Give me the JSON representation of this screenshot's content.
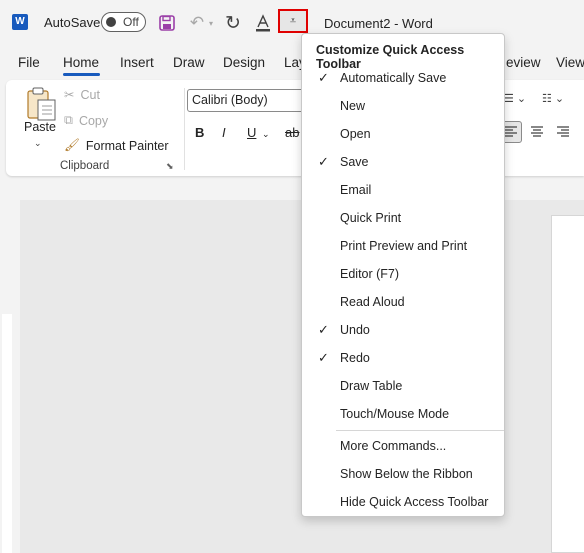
{
  "titlebar": {
    "app_badge": "W",
    "autosave_label": "AutoSave",
    "autosave_state": "Off",
    "doc_title": "Document2  -  Word",
    "customize_glyph": "⩡"
  },
  "tabs": [
    "File",
    "Home",
    "Insert",
    "Draw",
    "Design",
    "Lay",
    "eview",
    "View"
  ],
  "clipboard": {
    "paste_label": "Paste",
    "cut_label": "Cut",
    "copy_label": "Copy",
    "format_painter_label": "Format Painter",
    "group_label": "Clipboard"
  },
  "font": {
    "font_name": "Calibri (Body)",
    "bold": "B",
    "italic": "I",
    "underline": "U",
    "strike": "ab"
  },
  "menu": {
    "header": "Customize Quick Access Toolbar",
    "items": [
      {
        "label": "Automatically Save",
        "checked": true
      },
      {
        "label": "New",
        "checked": false
      },
      {
        "label": "Open",
        "checked": false
      },
      {
        "label": "Save",
        "checked": true
      },
      {
        "label": "Email",
        "checked": false
      },
      {
        "label": "Quick Print",
        "checked": false
      },
      {
        "label": "Print Preview and Print",
        "checked": false
      },
      {
        "label": "Editor (F7)",
        "checked": false
      },
      {
        "label": "Read Aloud",
        "checked": false
      },
      {
        "label": "Undo",
        "checked": true
      },
      {
        "label": "Redo",
        "checked": true
      },
      {
        "label": "Draw Table",
        "checked": false
      },
      {
        "label": "Touch/Mouse Mode",
        "checked": false
      }
    ],
    "more_commands": "More Commands...",
    "show_below": "Show Below the Ribbon",
    "hide_toolbar": "Hide Quick Access Toolbar"
  },
  "colors": {
    "accent": "#185abd",
    "highlight_box": "#e00000",
    "save_icon": "#9b3fa8"
  },
  "icons": [
    "word-logo-icon",
    "save-icon",
    "undo-icon",
    "redo-icon",
    "font-color-icon",
    "customize-dropdown-icon",
    "paste-icon",
    "cut-icon",
    "copy-icon",
    "format-painter-icon",
    "check-icon"
  ]
}
